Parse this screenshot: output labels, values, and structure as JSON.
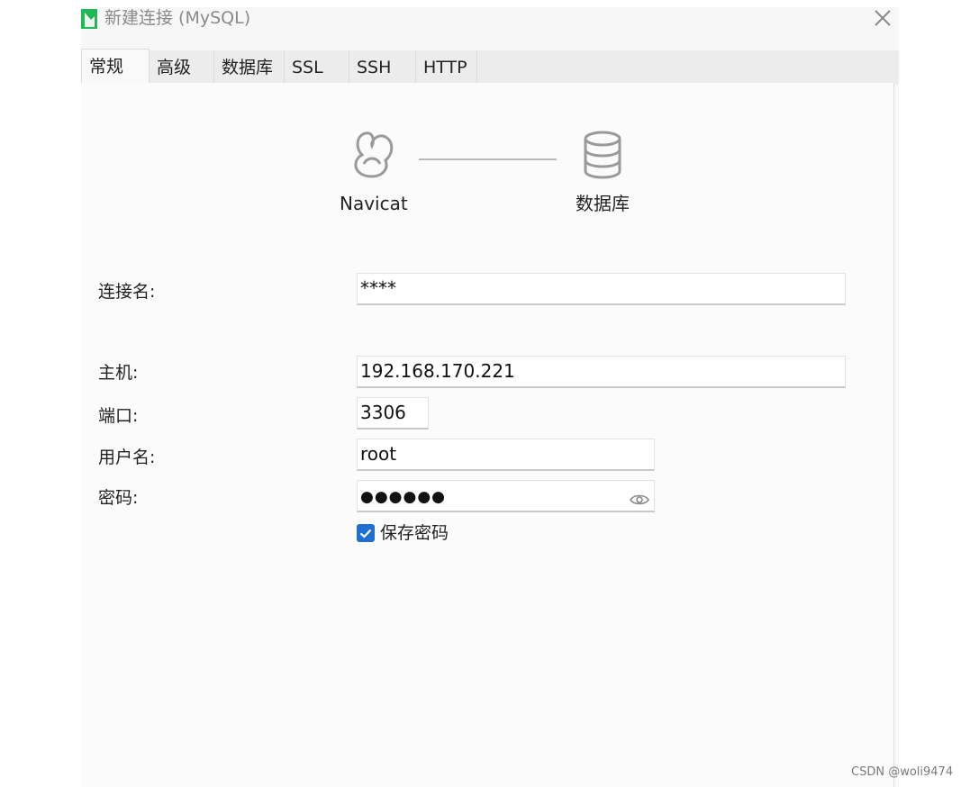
{
  "window": {
    "title": "新建连接 (MySQL)"
  },
  "tabs": [
    {
      "label": "常规",
      "active": true
    },
    {
      "label": "高级",
      "active": false
    },
    {
      "label": "数据库",
      "active": false
    },
    {
      "label": "SSL",
      "active": false
    },
    {
      "label": "SSH",
      "active": false
    },
    {
      "label": "HTTP",
      "active": false
    }
  ],
  "diagram": {
    "left_label": "Navicat",
    "right_label": "数据库",
    "left_icon": "navicat-logo-icon",
    "right_icon": "database-icon"
  },
  "form": {
    "connection_name": {
      "label": "连接名:",
      "value": "****"
    },
    "host": {
      "label": "主机:",
      "value": "192.168.170.221"
    },
    "port": {
      "label": "端口:",
      "value": "3306"
    },
    "username": {
      "label": "用户名:",
      "value": "root"
    },
    "password": {
      "label": "密码:",
      "value": "●●●●●●"
    },
    "save_password": {
      "label": "保存密码",
      "checked": true
    }
  },
  "watermark": "CSDN @woli9474",
  "colors": {
    "accent": "#1f6fd1",
    "logo_green": "#1db954"
  }
}
